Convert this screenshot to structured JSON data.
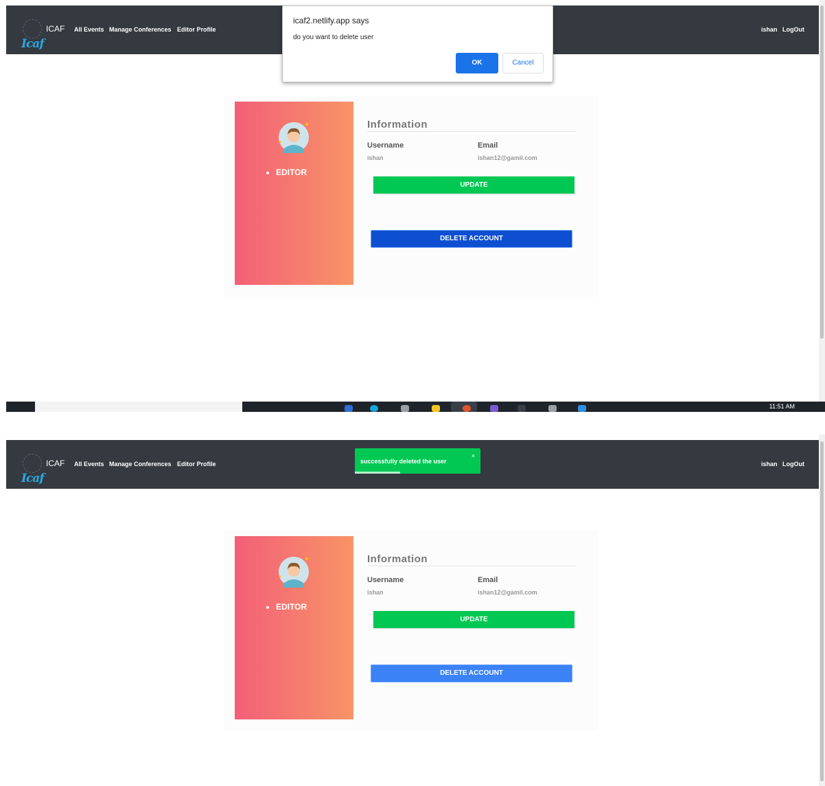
{
  "navbar": {
    "brand_script": "Icaf",
    "title": "ICAF",
    "links": [
      "All Events",
      "Manage Conferences",
      "Editor Profile"
    ],
    "user": "ishan",
    "logout": "LogOut"
  },
  "profile": {
    "role": "EDITOR",
    "info_title": "Information",
    "username_label": "Username",
    "username_value": "ishan",
    "email_label": "Email",
    "email_value": "ishan12@gamil.com",
    "update_label": "UPDATE",
    "delete_label": "DELETE ACCOUNT"
  },
  "alert_dialog": {
    "title": "icaf2.netlify.app says",
    "message": "do you want to delete user",
    "ok_label": "OK",
    "cancel_label": "Cancel"
  },
  "toast": {
    "message": "successfully deleted the user",
    "close": "×",
    "progress": 0.36
  },
  "taskbar": {
    "clock": "11:51 AM"
  },
  "colors": {
    "navbar": "#343a40",
    "gradient_start": "#f35f78",
    "gradient_end": "#f89466",
    "update_button": "#00c853",
    "delete_button_dialog": "#0d4fd0",
    "delete_button_normal": "#3b82f6",
    "dialog_ok": "#1a73e8",
    "toast": "#00c853"
  }
}
